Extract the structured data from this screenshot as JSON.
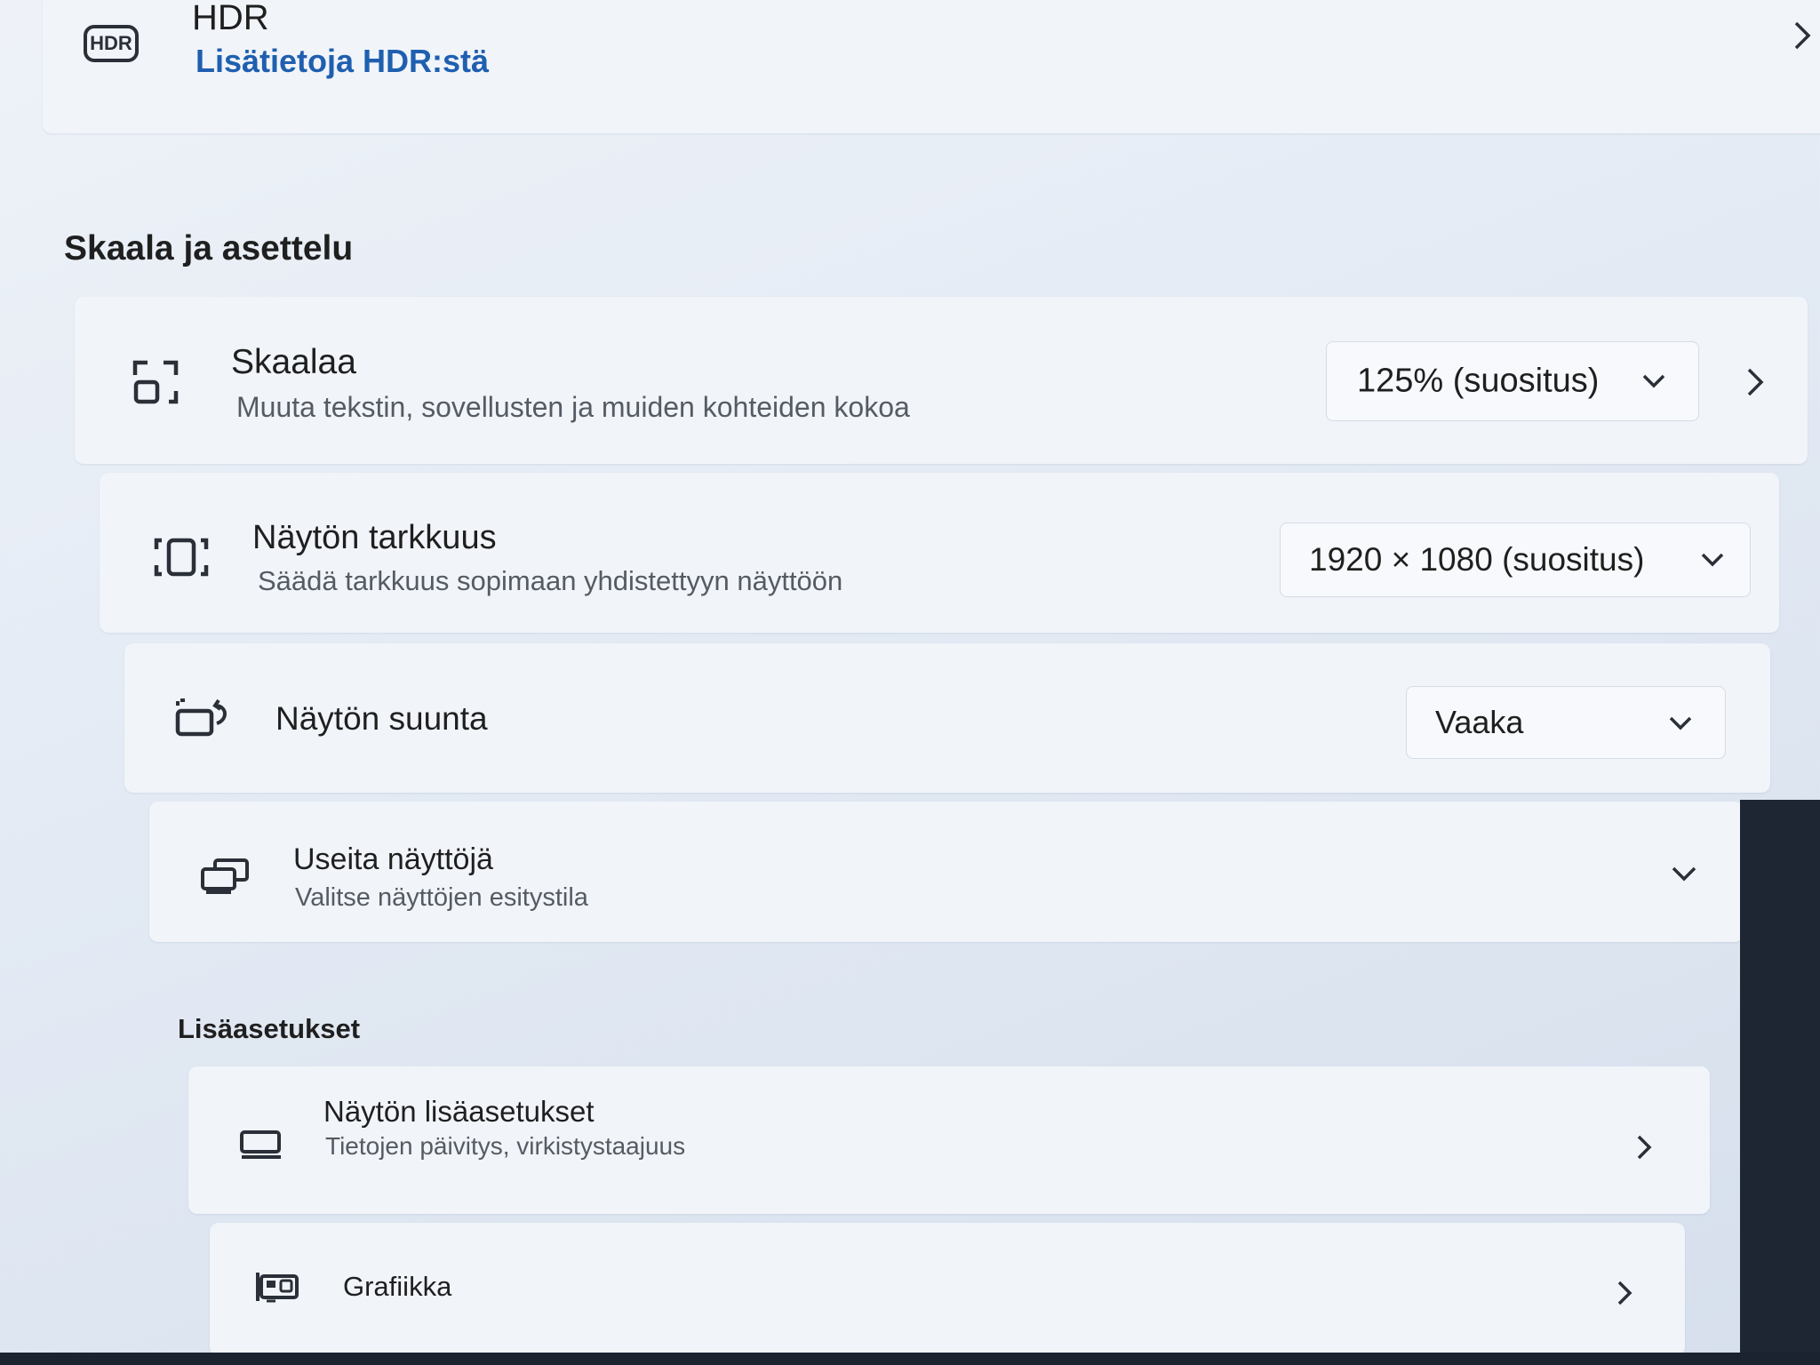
{
  "hdr": {
    "title": "HDR",
    "link": "Lisätietoja HDR:stä",
    "badge": "HDR"
  },
  "section_scale": "Skaala ja asettelu",
  "scale": {
    "title": "Skaalaa",
    "subtitle": "Muuta tekstin, sovellusten ja muiden kohteiden kokoa",
    "value": "125% (suositus)"
  },
  "resolution": {
    "title": "Näytön tarkkuus",
    "subtitle": "Säädä tarkkuus sopimaan yhdistettyyn näyttöön",
    "value": "1920 × 1080 (suositus)"
  },
  "orientation": {
    "title": "Näytön suunta",
    "value": "Vaaka"
  },
  "multiple": {
    "title": "Useita näyttöjä",
    "subtitle": "Valitse näyttöjen esitystila"
  },
  "section_advanced": "Lisäasetukset",
  "advanced_display": {
    "title": "Näytön lisäasetukset",
    "subtitle": "Tietojen päivitys, virkistystaajuus"
  },
  "graphics": {
    "title": "Grafiikka"
  }
}
